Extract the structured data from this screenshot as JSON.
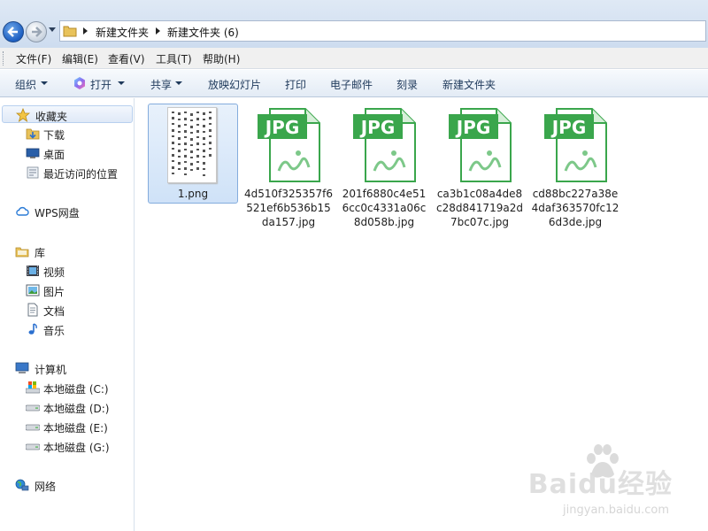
{
  "address": {
    "crumbs": [
      "新建文件夹",
      "新建文件夹 (6)"
    ]
  },
  "menu": [
    "文件(F)",
    "编辑(E)",
    "查看(V)",
    "工具(T)",
    "帮助(H)"
  ],
  "commands": {
    "organize": "组织",
    "open": "打开",
    "share": "共享",
    "slideshow": "放映幻灯片",
    "print": "打印",
    "email": "电子邮件",
    "burn": "刻录",
    "new_folder": "新建文件夹"
  },
  "nav": {
    "favorites": "收藏夹",
    "downloads": "下载",
    "desktop": "桌面",
    "recent": "最近访问的位置",
    "wps": "WPS网盘",
    "libraries": "库",
    "videos": "视频",
    "pictures": "图片",
    "documents": "文档",
    "music": "音乐",
    "computer": "计算机",
    "disk_c": "本地磁盘 (C:)",
    "disk_d": "本地磁盘 (D:)",
    "disk_e": "本地磁盘 (E:)",
    "disk_g": "本地磁盘 (G:)",
    "network": "网络"
  },
  "files": [
    {
      "name": "1.png",
      "icon": "image-thumbnail"
    },
    {
      "name": "4d510f325357f6521ef6b536b15da157.jpg",
      "icon_label": "JPG"
    },
    {
      "name": "201f6880c4e516cc0c4331a06c8d058b.jpg",
      "icon_label": "JPG"
    },
    {
      "name": "ca3b1c08a4de8c28d841719a2d7bc07c.jpg",
      "icon_label": "JPG"
    },
    {
      "name": "cd88bc227a38e4daf363570fc126d3de.jpg",
      "icon_label": "JPG"
    }
  ],
  "watermark": {
    "brand": "Baidu经验",
    "url": "jingyan.baidu.com"
  },
  "colors": {
    "jpg_green": "#3aa64c",
    "selection_blue": "#cfe2f8"
  }
}
